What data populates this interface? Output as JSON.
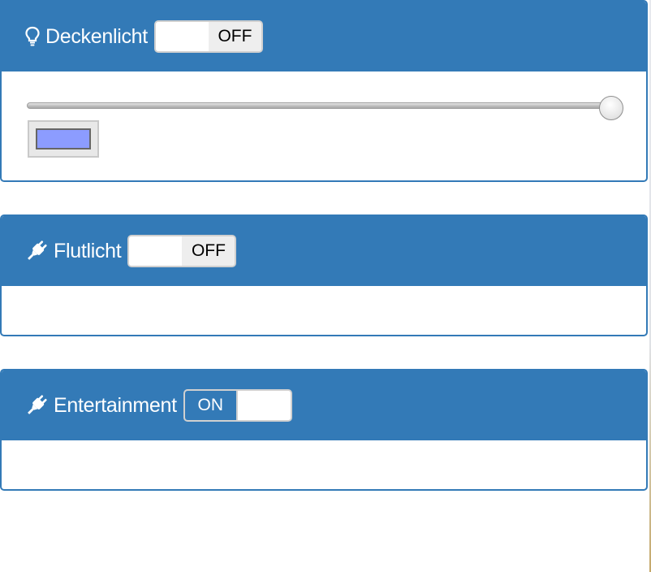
{
  "devices": [
    {
      "title": "Deckenlicht",
      "icon": "lightbulb-icon",
      "toggle_label": "OFF",
      "state": "off",
      "brightness_percent": 100,
      "color": "#8c9cff"
    },
    {
      "title": "Flutlicht",
      "icon": "plug-icon",
      "toggle_label": "OFF",
      "state": "off"
    },
    {
      "title": "Entertainment",
      "icon": "plug-icon",
      "toggle_label": "ON",
      "state": "on"
    }
  ],
  "colors": {
    "accent": "#337ab7",
    "toggle_border": "#d0d0d0",
    "toggle_off_bg": "#eeeeee"
  }
}
